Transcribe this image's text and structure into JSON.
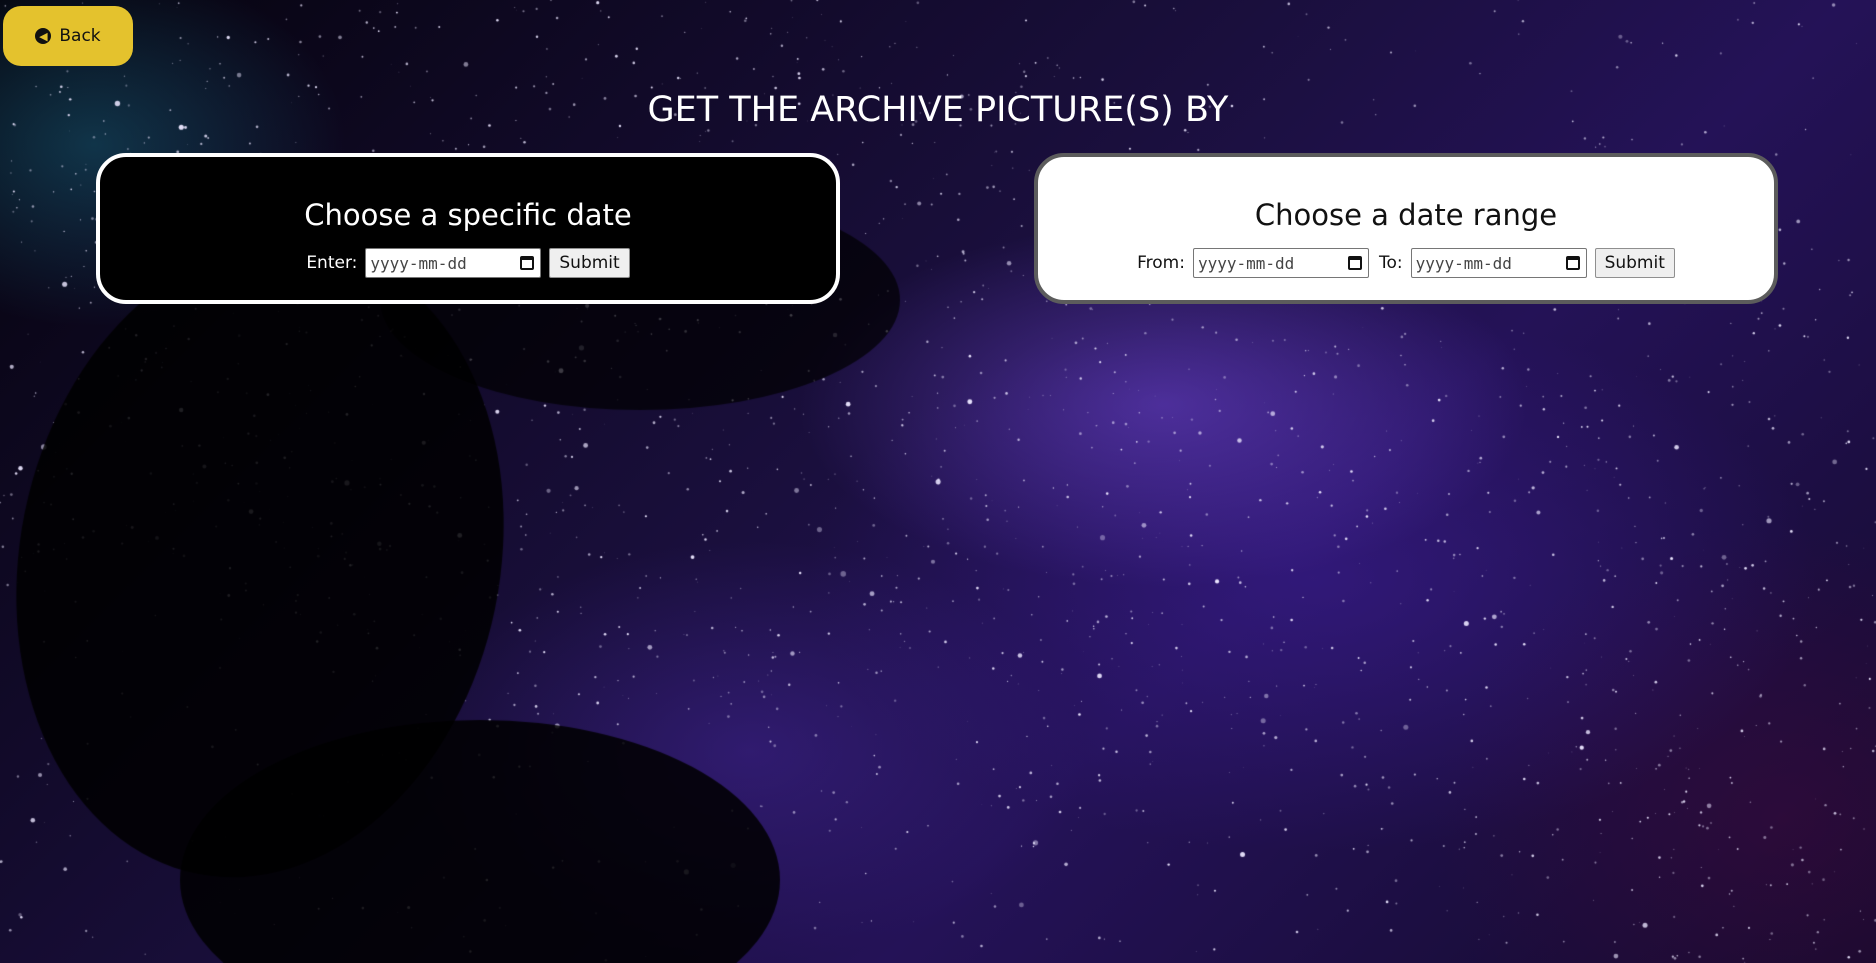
{
  "back_button": {
    "label": "Back",
    "icon": "circle-arrow-left-icon"
  },
  "page_title": "GET THE ARCHIVE PICTURE(S) BY",
  "specific_date_card": {
    "title": "Choose a specific date",
    "enter_label": "Enter:",
    "date_placeholder": "yyyy-mm-dd",
    "submit_label": "Submit"
  },
  "date_range_card": {
    "title": "Choose a date range",
    "from_label": "From:",
    "from_placeholder": "yyyy-mm-dd",
    "to_label": "To:",
    "to_placeholder": "yyyy-mm-dd",
    "submit_label": "Submit"
  },
  "colors": {
    "back_button": "#e4c22d",
    "specific_card_bg": "#000000",
    "range_card_bg": "#ffffff",
    "title_text": "#ffffff"
  }
}
